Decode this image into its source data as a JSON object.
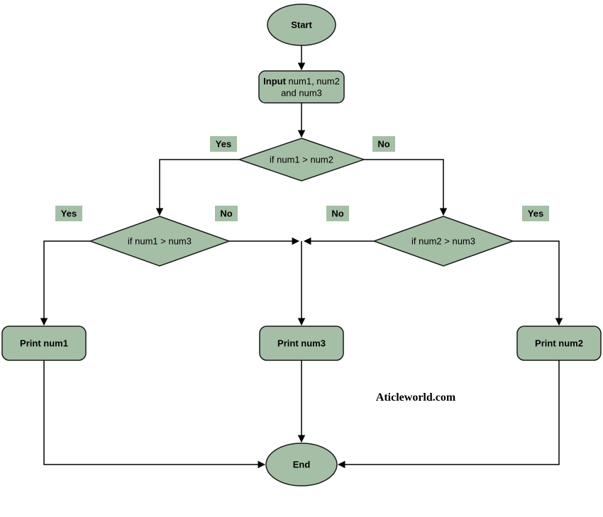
{
  "nodes": {
    "start": "Start",
    "input_prefix": "Input",
    "input_rest": " num1, num2",
    "input_line2": "and num3",
    "dec1": "if num1 > num2",
    "dec2": "if num1 > num3",
    "dec3": "if num2 > num3",
    "print1": "Print num1",
    "print2": "Print num2",
    "print3": "Print num3",
    "end": "End"
  },
  "labels": {
    "yes": "Yes",
    "no": "No"
  },
  "watermark": "Aticleworld.com"
}
